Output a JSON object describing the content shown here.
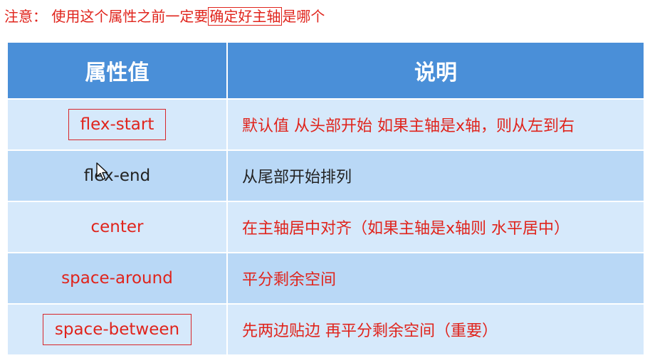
{
  "note": {
    "prefix": "注意：  使用这个属性之前一定要",
    "highlight": "确定好主轴",
    "suffix": "是哪个"
  },
  "table": {
    "headers": [
      "属性值",
      "说明"
    ],
    "rows": [
      {
        "value": "flex-start",
        "description": "默认值 从头部开始  如果主轴是x轴，则从左到右"
      },
      {
        "value": "flex-end",
        "description": "从尾部开始排列"
      },
      {
        "value": "center",
        "description": "在主轴居中对齐（如果主轴是x轴则 水平居中）"
      },
      {
        "value": "space-around",
        "description": "平分剩余空间"
      },
      {
        "value": "space-between",
        "description": "先两边贴边 再平分剩余空间（重要）"
      }
    ]
  },
  "colors": {
    "header_bg": "#4a8fd8",
    "row_light": "#d6e9fb",
    "row_dark": "#b9d8f6",
    "accent_red": "#e0241c"
  },
  "icons": [
    "mouse-cursor-icon"
  ]
}
